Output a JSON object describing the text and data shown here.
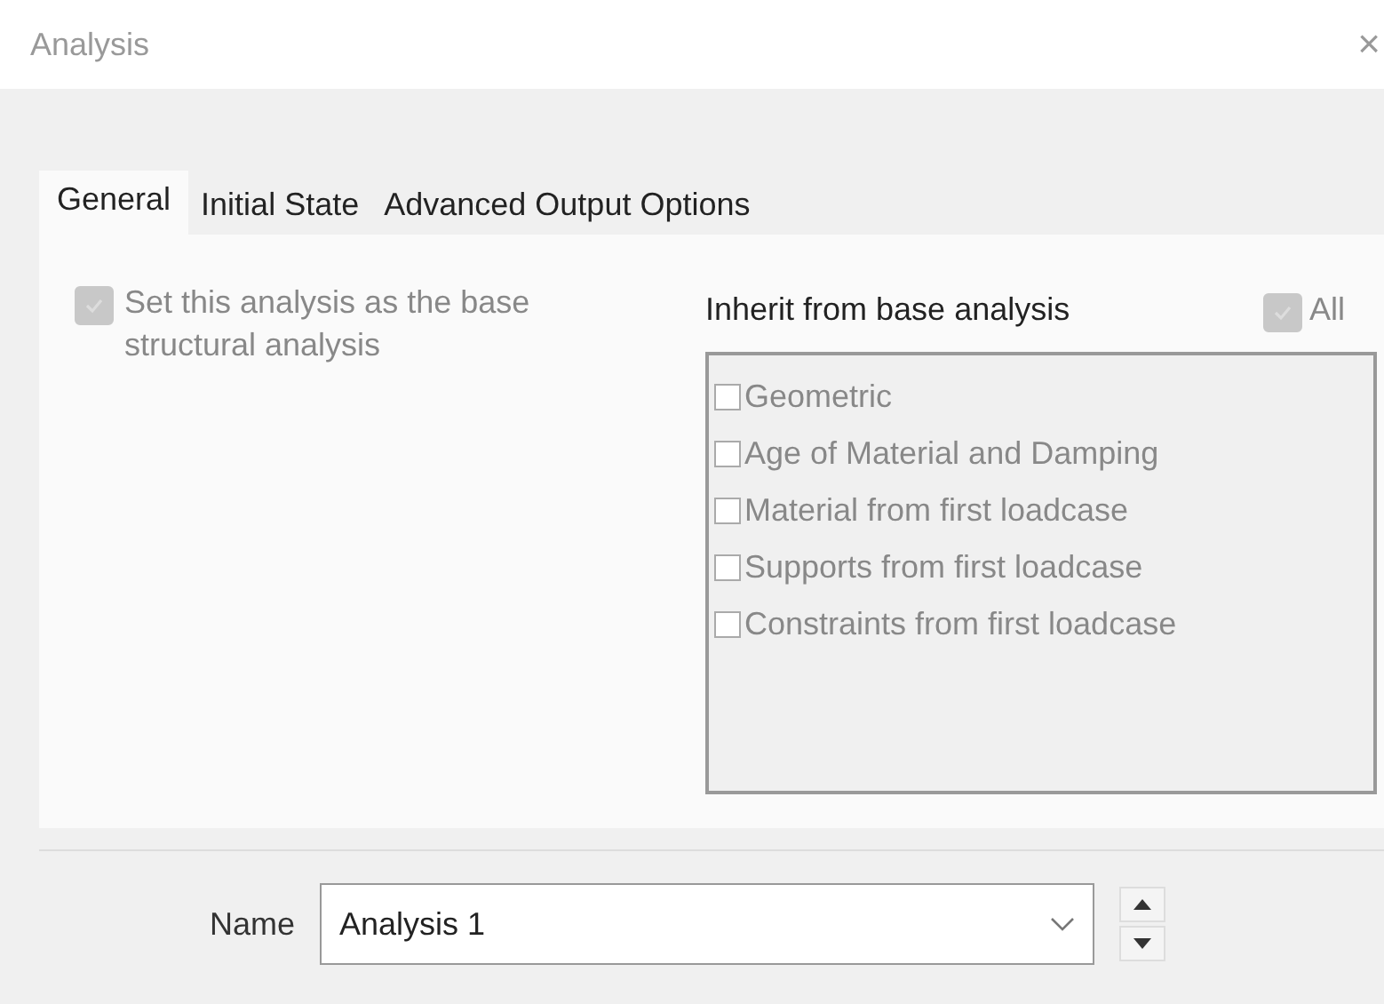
{
  "window": {
    "title": "Analysis",
    "close": "×"
  },
  "tabs": [
    {
      "label": "General",
      "selected": true
    },
    {
      "label": "Initial State",
      "selected": false
    },
    {
      "label": "Advanced Output Options",
      "selected": false
    }
  ],
  "base_analysis": {
    "label": "Set this analysis as the base structural analysis",
    "checked": true,
    "disabled": true
  },
  "inherit": {
    "title": "Inherit from base analysis",
    "all": {
      "label": "All",
      "checked": true,
      "disabled": true
    },
    "items": [
      {
        "label": "Geometric",
        "checked": false,
        "disabled": true
      },
      {
        "label": "Age of Material and Damping",
        "checked": false,
        "disabled": true
      },
      {
        "label": "Material from first loadcase",
        "checked": false,
        "disabled": true
      },
      {
        "label": "Supports from first loadcase",
        "checked": false,
        "disabled": true
      },
      {
        "label": "Constraints from first loadcase",
        "checked": false,
        "disabled": true
      }
    ]
  },
  "name_field": {
    "label": "Name",
    "value": "Analysis 1"
  }
}
